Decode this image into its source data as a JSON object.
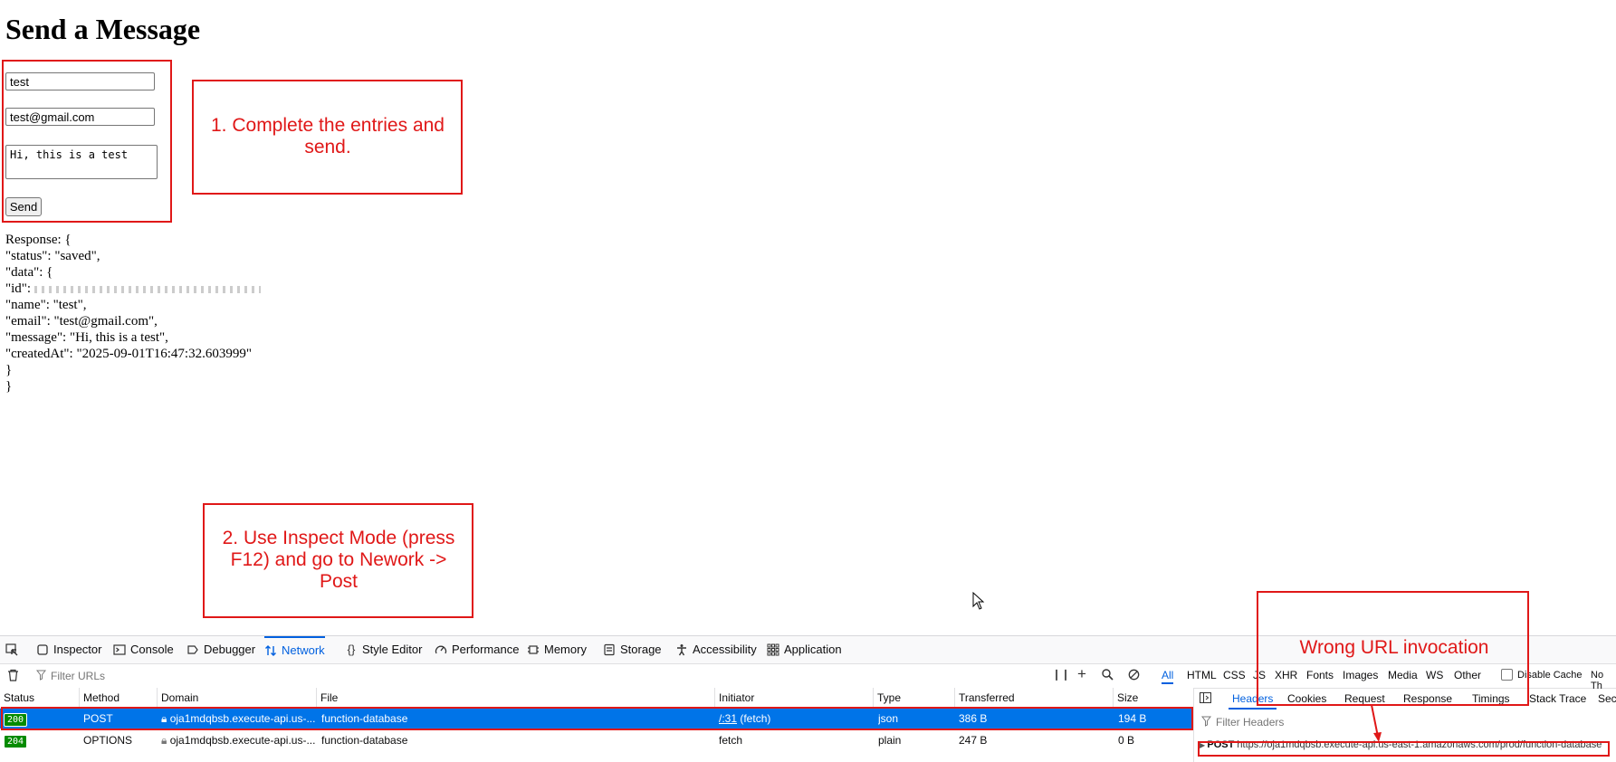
{
  "page": {
    "title": "Send a Message",
    "form": {
      "name_value": "test",
      "email_value": "test@gmail.com",
      "message_value": "Hi, this is a test",
      "send_label": "Send"
    },
    "response": {
      "lines": [
        "Response: {",
        "\"status\": \"saved\",",
        "\"data\": {",
        "\"id\": ",
        "\"name\": \"test\",",
        "\"email\": \"test@gmail.com\",",
        "\"message\": \"Hi, this is a test\",",
        "\"createdAt\": \"2025-09-01T16:47:32.603999\"",
        "}",
        "}"
      ]
    }
  },
  "annotations": {
    "note1": "1. Complete the entries and send.",
    "note2": "2. Use Inspect Mode (press F12) and go to Nework -> Post",
    "note3": "Wrong URL invocation",
    "color": "#e01818"
  },
  "devtools": {
    "tools": [
      {
        "label": "Inspector",
        "icon": "inspector-icon"
      },
      {
        "label": "Console",
        "icon": "console-icon"
      },
      {
        "label": "Debugger",
        "icon": "debugger-icon"
      },
      {
        "label": "Network",
        "icon": "network-icon"
      },
      {
        "label": "Style Editor",
        "icon": "style-editor-icon"
      },
      {
        "label": "Performance",
        "icon": "performance-icon"
      },
      {
        "label": "Memory",
        "icon": "memory-icon"
      },
      {
        "label": "Storage",
        "icon": "storage-icon"
      },
      {
        "label": "Accessibility",
        "icon": "accessibility-icon"
      },
      {
        "label": "Application",
        "icon": "application-icon"
      }
    ],
    "filter_placeholder": "Filter URLs",
    "type_filters": [
      "All",
      "HTML",
      "CSS",
      "JS",
      "XHR",
      "Fonts",
      "Images",
      "Media",
      "WS",
      "Other"
    ],
    "disable_cache": "Disable Cache",
    "throttle": "No Th",
    "columns": [
      "Status",
      "Method",
      "Domain",
      "File",
      "Initiator",
      "Type",
      "Transferred",
      "Size"
    ],
    "rows": [
      {
        "status": "200",
        "method": "POST",
        "domain": "oja1mdqbsb.execute-api.us-...",
        "file": "function-database",
        "initiator_link": "/:31",
        "initiator_extra": " (fetch)",
        "type": "json",
        "transferred": "386 B",
        "size": "194 B"
      },
      {
        "status": "204",
        "method": "OPTIONS",
        "domain": "oja1mdqbsb.execute-api.us-...",
        "file": "function-database",
        "initiator_link": "",
        "initiator_extra": "fetch",
        "type": "plain",
        "transferred": "247 B",
        "size": "0 B"
      }
    ],
    "side_tabs": [
      "Headers",
      "Cookies",
      "Request",
      "Response",
      "Timings",
      "Stack Trace",
      "Sec"
    ],
    "filter_headers_placeholder": "Filter Headers",
    "request_method": "POST",
    "request_url": "https://oja1mdqbsb.execute-api.us-east-1.amazonaws.com/prod/function-database",
    "accent": "#0060df",
    "selected_row": "#0074e8",
    "status_green": "#058b00"
  }
}
